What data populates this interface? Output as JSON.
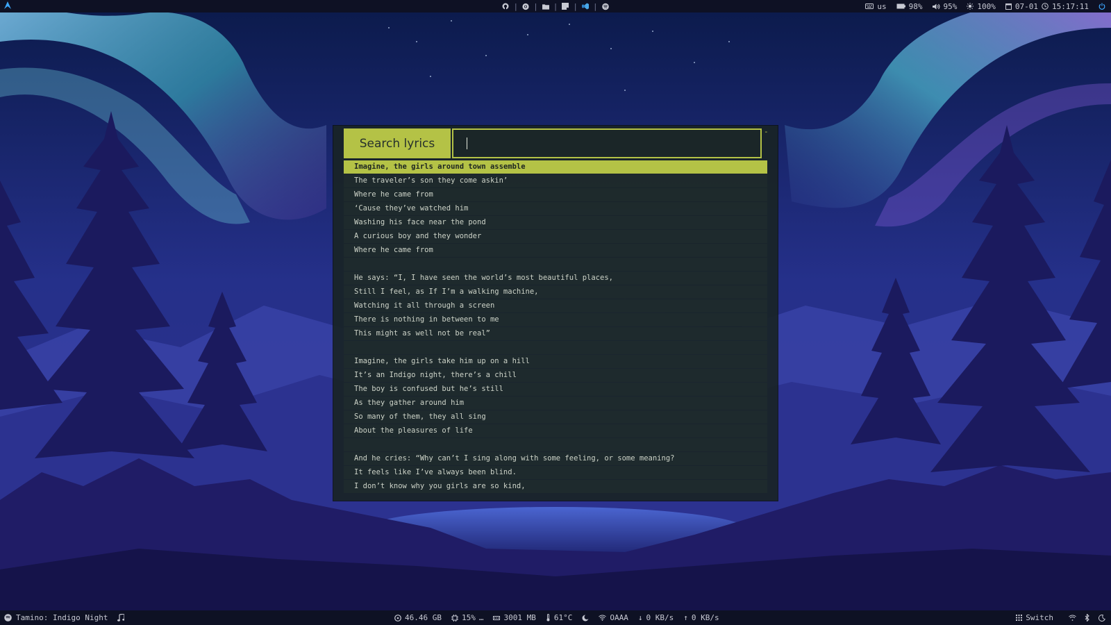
{
  "colors": {
    "accent": "#b4c246",
    "panel": "#192426",
    "bar": "#0e1124",
    "launcher_icon": "#3da7ff"
  },
  "topbar": {
    "launcher_icon": "arch-logo-icon",
    "apps": [
      {
        "icon": "github-icon"
      },
      {
        "icon": "chrome-icon"
      },
      {
        "icon": "folder-icon"
      },
      {
        "icon": "notes-icon"
      },
      {
        "icon": "vscode-icon"
      },
      {
        "icon": "spotify-icon"
      }
    ],
    "separator": "|",
    "keyboard_layout": "us",
    "battery": "98%",
    "volume": "95%",
    "brightness": "100%",
    "date": "07-01",
    "time": "15:17:11"
  },
  "dialog": {
    "prompt": "Search lyrics",
    "query": "",
    "dash": "-",
    "selected_index": 0,
    "lines": [
      "Imagine, the girls around town assemble",
      "The traveler’s son they come askin’",
      "Where he came from",
      "‘Cause they’ve watched him",
      "Washing his face near the pond",
      "A curious boy and they wonder",
      "Where he came from",
      "",
      "He says: “I, I have seen the world’s most beautiful places,",
      "Still I feel, as If I’m a walking machine,",
      "Watching it all through a screen",
      "There is nothing in between to me",
      "This might as well not be real”",
      "",
      "Imagine, the girls take him up on a hill",
      "It’s an Indigo night, there’s a chill",
      "The boy is confused but he’s still",
      "As they gather around him",
      "So many of them, they all sing",
      "About the pleasures of life",
      "",
      "And he cries: “Why can’t I sing along with some feeling, or some meaning?",
      "It feels like I’ve always been blind.",
      "I don’t know why you girls are so kind,"
    ]
  },
  "bottombar": {
    "now_playing": "Tamino: Indigo Night",
    "disk": "46.46 GB",
    "cpu": "15%",
    "cpu_more": "…",
    "memory": "3001 MB",
    "temperature": "61°C",
    "network_name": "OAAA",
    "download": "0 KB/s",
    "upload": "0 KB/s",
    "workspace_label": "Switch"
  }
}
